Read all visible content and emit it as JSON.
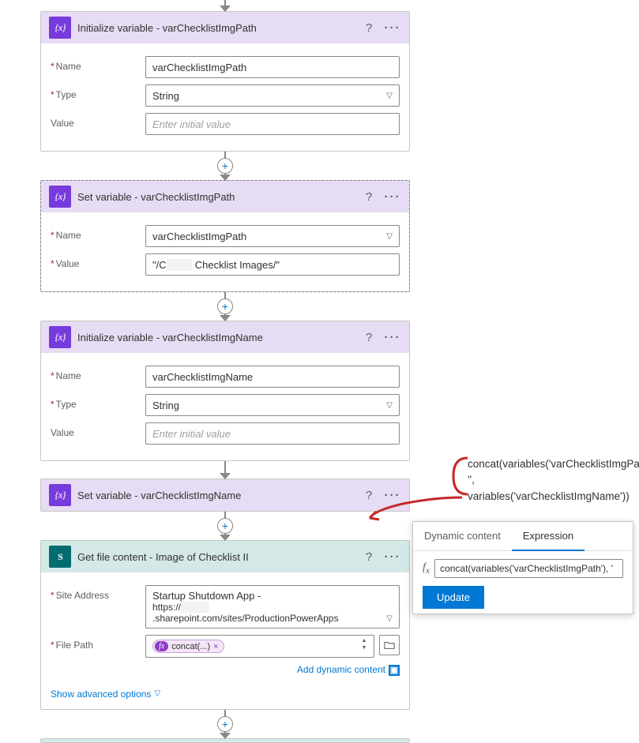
{
  "cards": {
    "initPath": {
      "title": "Initialize variable - varChecklistImgPath",
      "name_label": "Name",
      "name_value": "varChecklistImgPath",
      "type_label": "Type",
      "type_value": "String",
      "value_label": "Value",
      "value_placeholder": "Enter initial value"
    },
    "setPath": {
      "title": "Set variable - varChecklistImgPath",
      "name_label": "Name",
      "name_value": "varChecklistImgPath",
      "value_label": "Value",
      "value_prefix": "\"/C",
      "value_suffix": "Checklist Images/\""
    },
    "initName": {
      "title": "Initialize variable - varChecklistImgName",
      "name_label": "Name",
      "name_value": "varChecklistImgName",
      "type_label": "Type",
      "type_value": "String",
      "value_label": "Value",
      "value_placeholder": "Enter initial value"
    },
    "setName": {
      "title": "Set variable - varChecklistImgName"
    },
    "getFile": {
      "title": "Get file content - Image of Checklist II",
      "site_label": "Site Address",
      "site_line1": "Startup Shutdown App -",
      "site_line2a": "https://",
      "site_line2b": ".sharepoint.com/sites/ProductionPowerApps",
      "path_label": "File Path",
      "concat_pill": "concat(...)",
      "dynamic_link": "Add dynamic content",
      "advanced": "Show advanced options"
    }
  },
  "annotation": {
    "line1": "concat(variables('varChecklistImgPath'), '',",
    "line2": "variables('varChecklistImgName'))"
  },
  "popup": {
    "tab_dynamic": "Dynamic content",
    "tab_expression": "Expression",
    "expr_value": "concat(variables('varChecklistImgPath'), '",
    "update": "Update"
  },
  "icons": {
    "fx": "{x}",
    "s": "S",
    "fxsmall": "fx"
  }
}
